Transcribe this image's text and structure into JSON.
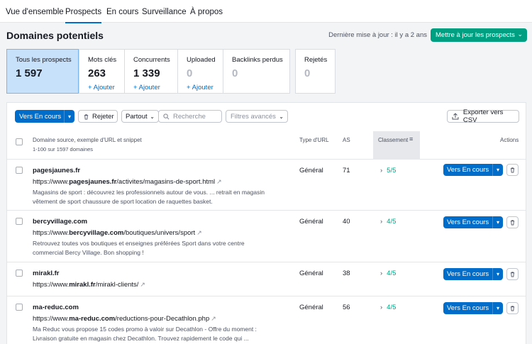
{
  "nav": {
    "tabs": [
      "Vue d'ensemble",
      "Prospects",
      "En cours",
      "Surveillance",
      "À propos"
    ],
    "active": "Prospects"
  },
  "header": {
    "title": "Domaines potentiels",
    "last_update": "Dernière mise à jour : il y a 2 ans",
    "update_button": "Mettre à jour les prospects"
  },
  "stats": [
    {
      "label": "Tous les prospects",
      "value": "1 597",
      "add": ""
    },
    {
      "label": "Mots clés",
      "value": "263",
      "add": "+ Ajouter"
    },
    {
      "label": "Concurrents",
      "value": "1 339",
      "add": "+ Ajouter"
    },
    {
      "label": "Uploaded",
      "value": "0",
      "add": "+ Ajouter"
    },
    {
      "label": "Backlinks perdus",
      "value": "0",
      "add": ""
    },
    {
      "label": "Rejetés",
      "value": "0",
      "add": ""
    }
  ],
  "toolbar": {
    "move_button": "Vers En cours",
    "reject_button": "Rejeter",
    "scope_select": "Partout",
    "search_placeholder": "Recherche",
    "advanced_filters": "Filtres avancés",
    "export_button": "Exporter vers CSV"
  },
  "table": {
    "col_domain": "Domaine source, exemple d'URL et snippet",
    "col_domain_sub": "1-100 sur 1597 domaines",
    "col_type": "Type d'URL",
    "col_as": "AS",
    "col_rank": "Classement",
    "col_actions": "Actions",
    "row_button": "Vers En cours",
    "rows": [
      {
        "domain": "pagesjaunes.fr",
        "url_prefix": "https://www.",
        "url_bold": "pagesjaunes.fr",
        "url_suffix": "/activites/magasins-de-sport.html",
        "snippet1": "Magasins de sport : découvrez les professionnels autour de vous. ... retrait en magasin",
        "snippet2": "vêtement de sport chaussure de sport location de raquettes basket.",
        "type": "Général",
        "as": "71",
        "rank": "5/5"
      },
      {
        "domain": "bercyvillage.com",
        "url_prefix": "https://www.",
        "url_bold": "bercyvillage.com",
        "url_suffix": "/boutiques/univers/sport",
        "snippet1": "Retrouvez toutes vos boutiques et enseignes préférées Sport dans votre centre",
        "snippet2": "commercial Bercy Village. Bon shopping !",
        "type": "Général",
        "as": "40",
        "rank": "4/5"
      },
      {
        "domain": "mirakl.fr",
        "url_prefix": "https://www.",
        "url_bold": "mirakl.fr",
        "url_suffix": "/mirakl-clients/",
        "snippet1": "",
        "snippet2": "",
        "type": "Général",
        "as": "38",
        "rank": "4/5"
      },
      {
        "domain": "ma-reduc.com",
        "url_prefix": "https://www.",
        "url_bold": "ma-reduc.com",
        "url_suffix": "/reductions-pour-Decathlon.php",
        "snippet1": "Ma Reduc vous propose 15 codes promo à valoir sur Decathlon - Offre du moment :",
        "snippet2": "Livraison gratuite en magasin chez Decathlon. Trouvez rapidement le code qui ...",
        "type": "Général",
        "as": "56",
        "rank": "4/5"
      }
    ]
  },
  "colors": {
    "accent": "#006dca",
    "success": "#009f81",
    "active_tab_bg": "#c7e1fb"
  }
}
